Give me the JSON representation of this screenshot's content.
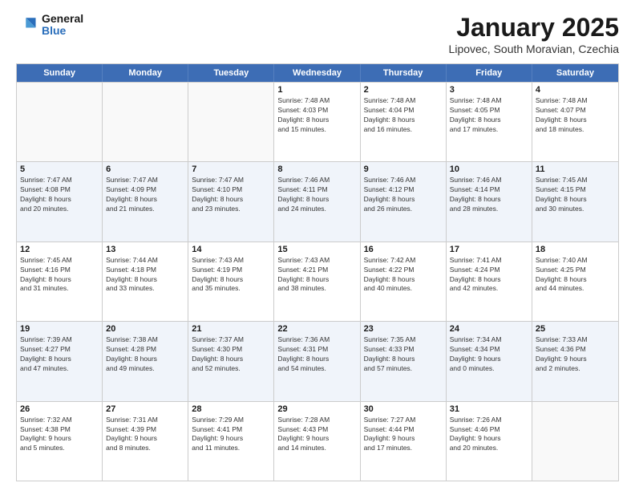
{
  "logo": {
    "general": "General",
    "blue": "Blue"
  },
  "title": "January 2025",
  "subtitle": "Lipovec, South Moravian, Czechia",
  "days": [
    "Sunday",
    "Monday",
    "Tuesday",
    "Wednesday",
    "Thursday",
    "Friday",
    "Saturday"
  ],
  "weeks": [
    [
      {
        "num": "",
        "info": ""
      },
      {
        "num": "",
        "info": ""
      },
      {
        "num": "",
        "info": ""
      },
      {
        "num": "1",
        "info": "Sunrise: 7:48 AM\nSunset: 4:03 PM\nDaylight: 8 hours\nand 15 minutes."
      },
      {
        "num": "2",
        "info": "Sunrise: 7:48 AM\nSunset: 4:04 PM\nDaylight: 8 hours\nand 16 minutes."
      },
      {
        "num": "3",
        "info": "Sunrise: 7:48 AM\nSunset: 4:05 PM\nDaylight: 8 hours\nand 17 minutes."
      },
      {
        "num": "4",
        "info": "Sunrise: 7:48 AM\nSunset: 4:07 PM\nDaylight: 8 hours\nand 18 minutes."
      }
    ],
    [
      {
        "num": "5",
        "info": "Sunrise: 7:47 AM\nSunset: 4:08 PM\nDaylight: 8 hours\nand 20 minutes."
      },
      {
        "num": "6",
        "info": "Sunrise: 7:47 AM\nSunset: 4:09 PM\nDaylight: 8 hours\nand 21 minutes."
      },
      {
        "num": "7",
        "info": "Sunrise: 7:47 AM\nSunset: 4:10 PM\nDaylight: 8 hours\nand 23 minutes."
      },
      {
        "num": "8",
        "info": "Sunrise: 7:46 AM\nSunset: 4:11 PM\nDaylight: 8 hours\nand 24 minutes."
      },
      {
        "num": "9",
        "info": "Sunrise: 7:46 AM\nSunset: 4:12 PM\nDaylight: 8 hours\nand 26 minutes."
      },
      {
        "num": "10",
        "info": "Sunrise: 7:46 AM\nSunset: 4:14 PM\nDaylight: 8 hours\nand 28 minutes."
      },
      {
        "num": "11",
        "info": "Sunrise: 7:45 AM\nSunset: 4:15 PM\nDaylight: 8 hours\nand 30 minutes."
      }
    ],
    [
      {
        "num": "12",
        "info": "Sunrise: 7:45 AM\nSunset: 4:16 PM\nDaylight: 8 hours\nand 31 minutes."
      },
      {
        "num": "13",
        "info": "Sunrise: 7:44 AM\nSunset: 4:18 PM\nDaylight: 8 hours\nand 33 minutes."
      },
      {
        "num": "14",
        "info": "Sunrise: 7:43 AM\nSunset: 4:19 PM\nDaylight: 8 hours\nand 35 minutes."
      },
      {
        "num": "15",
        "info": "Sunrise: 7:43 AM\nSunset: 4:21 PM\nDaylight: 8 hours\nand 38 minutes."
      },
      {
        "num": "16",
        "info": "Sunrise: 7:42 AM\nSunset: 4:22 PM\nDaylight: 8 hours\nand 40 minutes."
      },
      {
        "num": "17",
        "info": "Sunrise: 7:41 AM\nSunset: 4:24 PM\nDaylight: 8 hours\nand 42 minutes."
      },
      {
        "num": "18",
        "info": "Sunrise: 7:40 AM\nSunset: 4:25 PM\nDaylight: 8 hours\nand 44 minutes."
      }
    ],
    [
      {
        "num": "19",
        "info": "Sunrise: 7:39 AM\nSunset: 4:27 PM\nDaylight: 8 hours\nand 47 minutes."
      },
      {
        "num": "20",
        "info": "Sunrise: 7:38 AM\nSunset: 4:28 PM\nDaylight: 8 hours\nand 49 minutes."
      },
      {
        "num": "21",
        "info": "Sunrise: 7:37 AM\nSunset: 4:30 PM\nDaylight: 8 hours\nand 52 minutes."
      },
      {
        "num": "22",
        "info": "Sunrise: 7:36 AM\nSunset: 4:31 PM\nDaylight: 8 hours\nand 54 minutes."
      },
      {
        "num": "23",
        "info": "Sunrise: 7:35 AM\nSunset: 4:33 PM\nDaylight: 8 hours\nand 57 minutes."
      },
      {
        "num": "24",
        "info": "Sunrise: 7:34 AM\nSunset: 4:34 PM\nDaylight: 9 hours\nand 0 minutes."
      },
      {
        "num": "25",
        "info": "Sunrise: 7:33 AM\nSunset: 4:36 PM\nDaylight: 9 hours\nand 2 minutes."
      }
    ],
    [
      {
        "num": "26",
        "info": "Sunrise: 7:32 AM\nSunset: 4:38 PM\nDaylight: 9 hours\nand 5 minutes."
      },
      {
        "num": "27",
        "info": "Sunrise: 7:31 AM\nSunset: 4:39 PM\nDaylight: 9 hours\nand 8 minutes."
      },
      {
        "num": "28",
        "info": "Sunrise: 7:29 AM\nSunset: 4:41 PM\nDaylight: 9 hours\nand 11 minutes."
      },
      {
        "num": "29",
        "info": "Sunrise: 7:28 AM\nSunset: 4:43 PM\nDaylight: 9 hours\nand 14 minutes."
      },
      {
        "num": "30",
        "info": "Sunrise: 7:27 AM\nSunset: 4:44 PM\nDaylight: 9 hours\nand 17 minutes."
      },
      {
        "num": "31",
        "info": "Sunrise: 7:26 AM\nSunset: 4:46 PM\nDaylight: 9 hours\nand 20 minutes."
      },
      {
        "num": "",
        "info": ""
      }
    ]
  ]
}
